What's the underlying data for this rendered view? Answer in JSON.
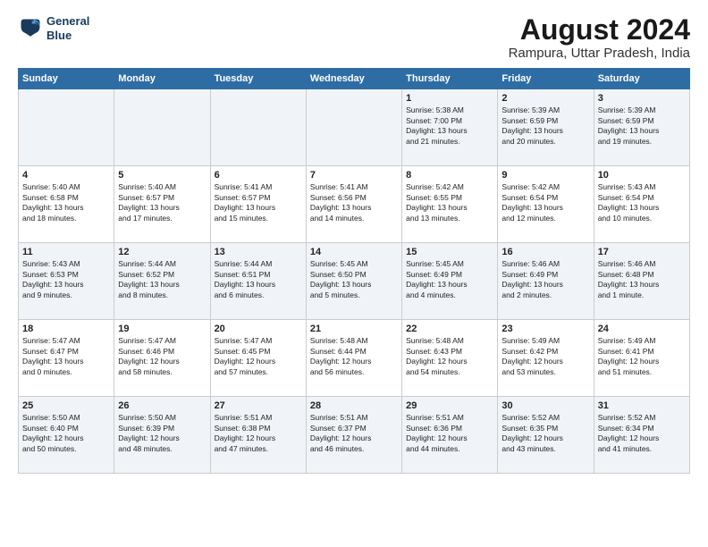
{
  "header": {
    "logo_line1": "General",
    "logo_line2": "Blue",
    "main_title": "August 2024",
    "subtitle": "Rampura, Uttar Pradesh, India"
  },
  "days_of_week": [
    "Sunday",
    "Monday",
    "Tuesday",
    "Wednesday",
    "Thursday",
    "Friday",
    "Saturday"
  ],
  "weeks": [
    [
      {
        "day": "",
        "info": ""
      },
      {
        "day": "",
        "info": ""
      },
      {
        "day": "",
        "info": ""
      },
      {
        "day": "",
        "info": ""
      },
      {
        "day": "1",
        "info": "Sunrise: 5:38 AM\nSunset: 7:00 PM\nDaylight: 13 hours\nand 21 minutes."
      },
      {
        "day": "2",
        "info": "Sunrise: 5:39 AM\nSunset: 6:59 PM\nDaylight: 13 hours\nand 20 minutes."
      },
      {
        "day": "3",
        "info": "Sunrise: 5:39 AM\nSunset: 6:59 PM\nDaylight: 13 hours\nand 19 minutes."
      }
    ],
    [
      {
        "day": "4",
        "info": "Sunrise: 5:40 AM\nSunset: 6:58 PM\nDaylight: 13 hours\nand 18 minutes."
      },
      {
        "day": "5",
        "info": "Sunrise: 5:40 AM\nSunset: 6:57 PM\nDaylight: 13 hours\nand 17 minutes."
      },
      {
        "day": "6",
        "info": "Sunrise: 5:41 AM\nSunset: 6:57 PM\nDaylight: 13 hours\nand 15 minutes."
      },
      {
        "day": "7",
        "info": "Sunrise: 5:41 AM\nSunset: 6:56 PM\nDaylight: 13 hours\nand 14 minutes."
      },
      {
        "day": "8",
        "info": "Sunrise: 5:42 AM\nSunset: 6:55 PM\nDaylight: 13 hours\nand 13 minutes."
      },
      {
        "day": "9",
        "info": "Sunrise: 5:42 AM\nSunset: 6:54 PM\nDaylight: 13 hours\nand 12 minutes."
      },
      {
        "day": "10",
        "info": "Sunrise: 5:43 AM\nSunset: 6:54 PM\nDaylight: 13 hours\nand 10 minutes."
      }
    ],
    [
      {
        "day": "11",
        "info": "Sunrise: 5:43 AM\nSunset: 6:53 PM\nDaylight: 13 hours\nand 9 minutes."
      },
      {
        "day": "12",
        "info": "Sunrise: 5:44 AM\nSunset: 6:52 PM\nDaylight: 13 hours\nand 8 minutes."
      },
      {
        "day": "13",
        "info": "Sunrise: 5:44 AM\nSunset: 6:51 PM\nDaylight: 13 hours\nand 6 minutes."
      },
      {
        "day": "14",
        "info": "Sunrise: 5:45 AM\nSunset: 6:50 PM\nDaylight: 13 hours\nand 5 minutes."
      },
      {
        "day": "15",
        "info": "Sunrise: 5:45 AM\nSunset: 6:49 PM\nDaylight: 13 hours\nand 4 minutes."
      },
      {
        "day": "16",
        "info": "Sunrise: 5:46 AM\nSunset: 6:49 PM\nDaylight: 13 hours\nand 2 minutes."
      },
      {
        "day": "17",
        "info": "Sunrise: 5:46 AM\nSunset: 6:48 PM\nDaylight: 13 hours\nand 1 minute."
      }
    ],
    [
      {
        "day": "18",
        "info": "Sunrise: 5:47 AM\nSunset: 6:47 PM\nDaylight: 13 hours\nand 0 minutes."
      },
      {
        "day": "19",
        "info": "Sunrise: 5:47 AM\nSunset: 6:46 PM\nDaylight: 12 hours\nand 58 minutes."
      },
      {
        "day": "20",
        "info": "Sunrise: 5:47 AM\nSunset: 6:45 PM\nDaylight: 12 hours\nand 57 minutes."
      },
      {
        "day": "21",
        "info": "Sunrise: 5:48 AM\nSunset: 6:44 PM\nDaylight: 12 hours\nand 56 minutes."
      },
      {
        "day": "22",
        "info": "Sunrise: 5:48 AM\nSunset: 6:43 PM\nDaylight: 12 hours\nand 54 minutes."
      },
      {
        "day": "23",
        "info": "Sunrise: 5:49 AM\nSunset: 6:42 PM\nDaylight: 12 hours\nand 53 minutes."
      },
      {
        "day": "24",
        "info": "Sunrise: 5:49 AM\nSunset: 6:41 PM\nDaylight: 12 hours\nand 51 minutes."
      }
    ],
    [
      {
        "day": "25",
        "info": "Sunrise: 5:50 AM\nSunset: 6:40 PM\nDaylight: 12 hours\nand 50 minutes."
      },
      {
        "day": "26",
        "info": "Sunrise: 5:50 AM\nSunset: 6:39 PM\nDaylight: 12 hours\nand 48 minutes."
      },
      {
        "day": "27",
        "info": "Sunrise: 5:51 AM\nSunset: 6:38 PM\nDaylight: 12 hours\nand 47 minutes."
      },
      {
        "day": "28",
        "info": "Sunrise: 5:51 AM\nSunset: 6:37 PM\nDaylight: 12 hours\nand 46 minutes."
      },
      {
        "day": "29",
        "info": "Sunrise: 5:51 AM\nSunset: 6:36 PM\nDaylight: 12 hours\nand 44 minutes."
      },
      {
        "day": "30",
        "info": "Sunrise: 5:52 AM\nSunset: 6:35 PM\nDaylight: 12 hours\nand 43 minutes."
      },
      {
        "day": "31",
        "info": "Sunrise: 5:52 AM\nSunset: 6:34 PM\nDaylight: 12 hours\nand 41 minutes."
      }
    ]
  ]
}
